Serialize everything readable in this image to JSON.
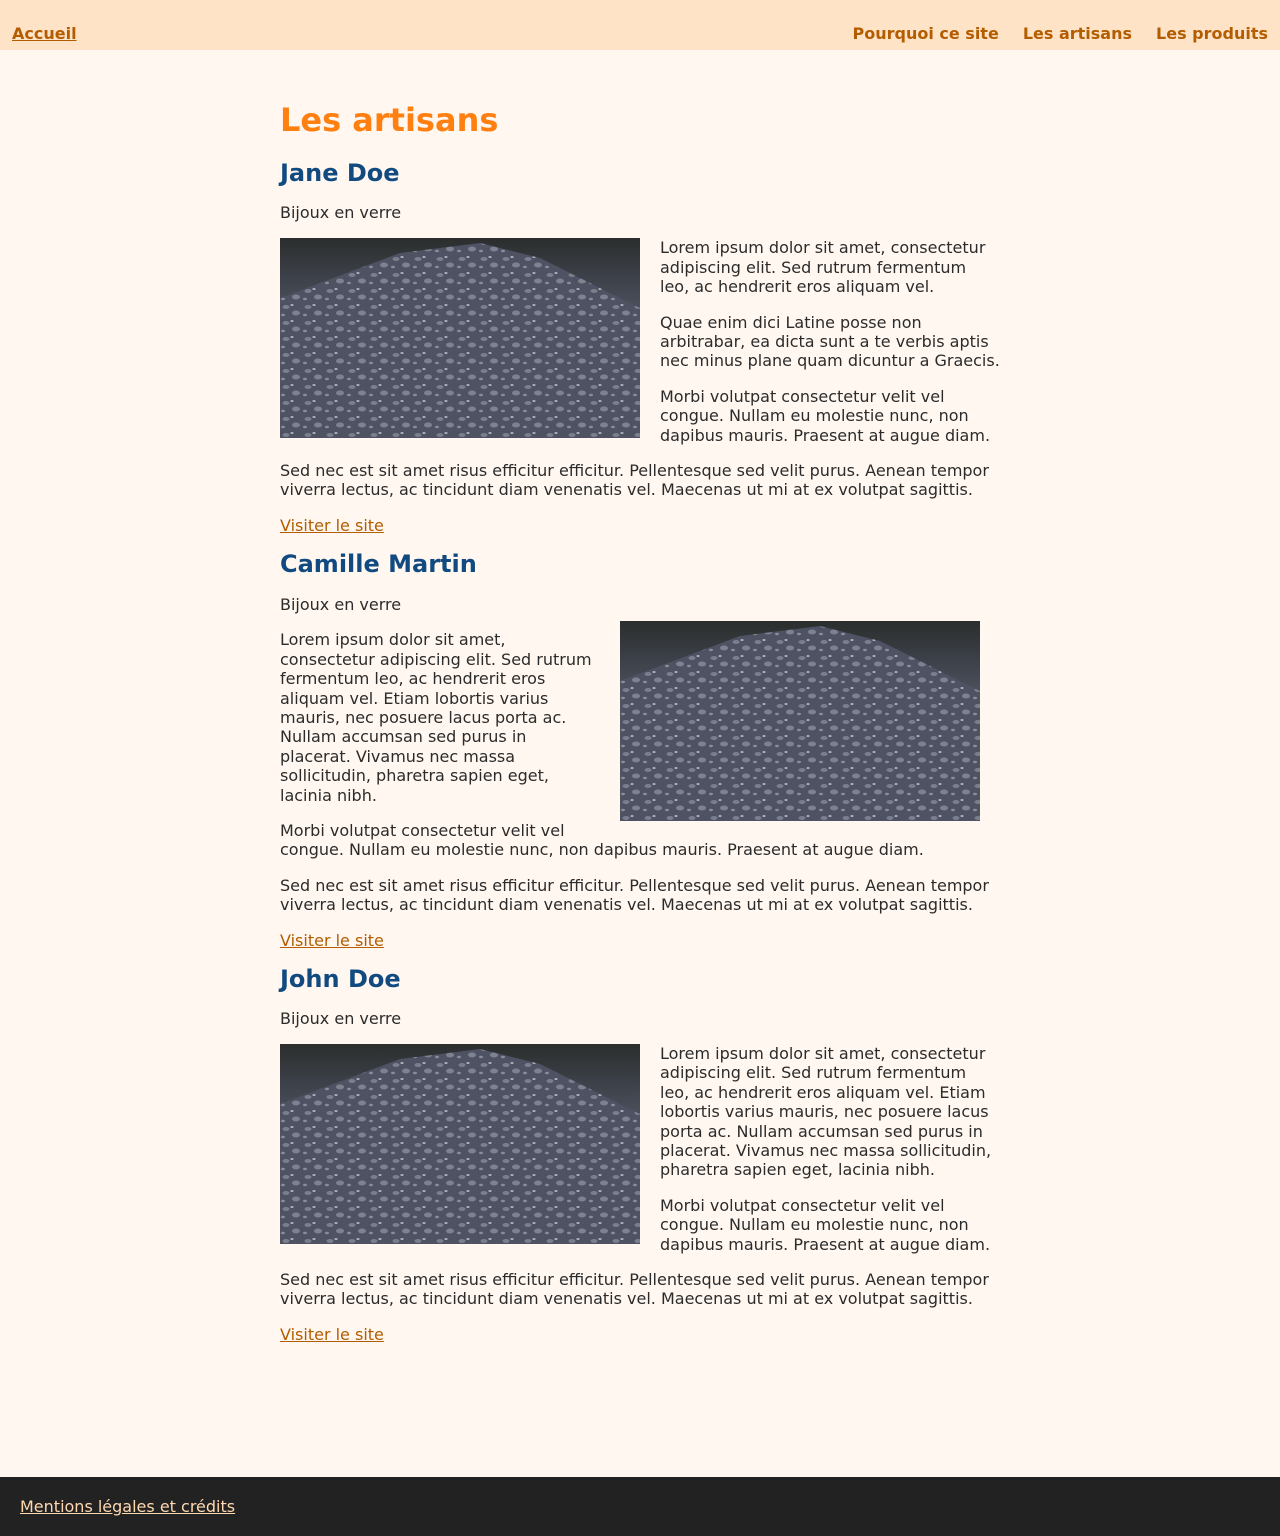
{
  "header": {
    "home_label": "Accueil",
    "nav": [
      "Pourquoi ce site",
      "Les artisans",
      "Les produits"
    ]
  },
  "page_title": "Les artisans",
  "artisans": [
    {
      "name": "Jane Doe",
      "craft": "Bijoux en verre",
      "paragraphs": [
        "Lorem ipsum dolor sit amet, consectetur adipiscing elit. Sed rutrum fermentum leo, ac hendrerit eros aliquam vel.",
        "Quae enim dici Latine posse non arbitrabar, ea dicta sunt a te verbis aptis nec minus plane quam dicuntur a Graecis.",
        "Morbi volutpat consectetur velit vel congue. Nullam eu molestie nunc, non dapibus mauris. Praesent at augue diam.",
        "Sed nec est sit amet risus efficitur efficitur. Pellentesque sed velit purus. Aenean tempor viverra lectus, ac tincidunt diam venenatis vel. Maecenas ut mi at ex volutpat sagittis."
      ],
      "link": "Visiter le site"
    },
    {
      "name": "Camille Martin",
      "craft": "Bijoux en verre",
      "paragraphs": [
        "Lorem ipsum dolor sit amet, consectetur adipiscing elit. Sed rutrum fermentum leo, ac hendrerit eros aliquam vel. Etiam lobortis varius mauris, nec posuere lacus porta ac. Nullam accumsan sed purus in placerat. Vivamus nec massa sollicitudin, pharetra sapien eget, lacinia nibh.",
        "Morbi volutpat consectetur velit vel congue. Nullam eu molestie nunc, non dapibus mauris. Praesent at augue diam.",
        "Sed nec est sit amet risus efficitur efficitur. Pellentesque sed velit purus. Aenean tempor viverra lectus, ac tincidunt diam venenatis vel. Maecenas ut mi at ex volutpat sagittis."
      ],
      "link": "Visiter le site"
    },
    {
      "name": "John Doe",
      "craft": "Bijoux en verre",
      "paragraphs": [
        "Lorem ipsum dolor sit amet, consectetur adipiscing elit. Sed rutrum fermentum leo, ac hendrerit eros aliquam vel. Etiam lobortis varius mauris, nec posuere lacus porta ac. Nullam accumsan sed purus in placerat. Vivamus nec massa sollicitudin, pharetra sapien eget, lacinia nibh.",
        "Morbi volutpat consectetur velit vel congue. Nullam eu molestie nunc, non dapibus mauris. Praesent at augue diam.",
        "Sed nec est sit amet risus efficitur efficitur. Pellentesque sed velit purus. Aenean tempor viverra lectus, ac tincidunt diam venenatis vel. Maecenas ut mi at ex volutpat sagittis."
      ],
      "link": "Visiter le site"
    }
  ],
  "footer": {
    "link": "Mentions légales et crédits"
  },
  "colors": {
    "accent": "#ff7f10",
    "heading": "#114a80",
    "link": "#b35c00",
    "header_bg": "#ffe3c7",
    "page_bg": "#fff7f0",
    "footer_bg": "#222222"
  }
}
